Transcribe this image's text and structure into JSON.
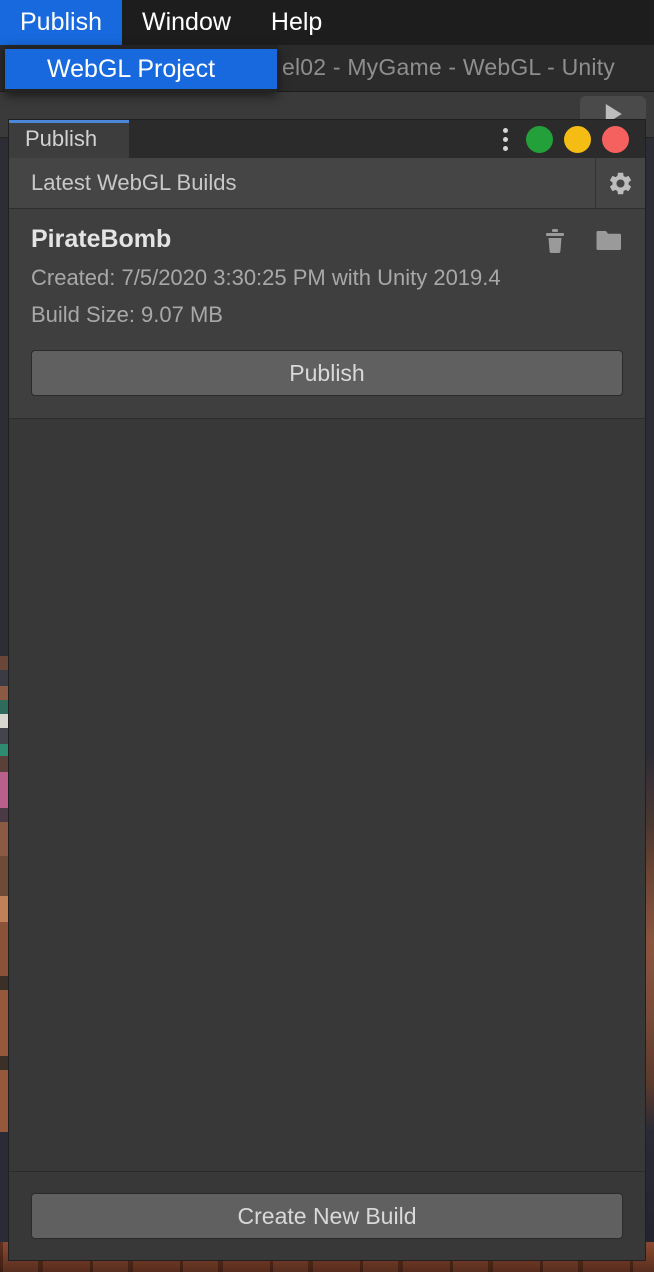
{
  "menubar": {
    "items": [
      {
        "label": "Publish",
        "active": true
      },
      {
        "label": "Window",
        "active": false
      },
      {
        "label": "Help",
        "active": false
      }
    ],
    "dropdown": {
      "parent": "Publish",
      "items": [
        {
          "label": "WebGL Project",
          "highlighted": true
        }
      ]
    }
  },
  "window_title": "el02 - MyGame - WebGL - Unity",
  "publish_window": {
    "tab": {
      "label": "Publish",
      "selected": true,
      "accent_color": "#4b87d8"
    },
    "window_controls": {
      "kebab_icon": "kebab-menu-icon",
      "buttons": [
        {
          "name": "minimize",
          "color": "#24a03b"
        },
        {
          "name": "maximize",
          "color": "#f5bc13"
        },
        {
          "name": "close",
          "color": "#f5615e"
        }
      ]
    },
    "section": {
      "title": "Latest WebGL Builds",
      "settings_icon": "gear-icon"
    },
    "build": {
      "name": "PirateBomb",
      "created": "Created: 7/5/2020 3:30:25 PM with Unity 2019.4",
      "build_size": "Build Size: 9.07 MB",
      "delete_icon": "trash-icon",
      "open_folder_icon": "folder-icon",
      "publish_button": "Publish"
    },
    "footer": {
      "create_build_button": "Create New Build"
    }
  }
}
